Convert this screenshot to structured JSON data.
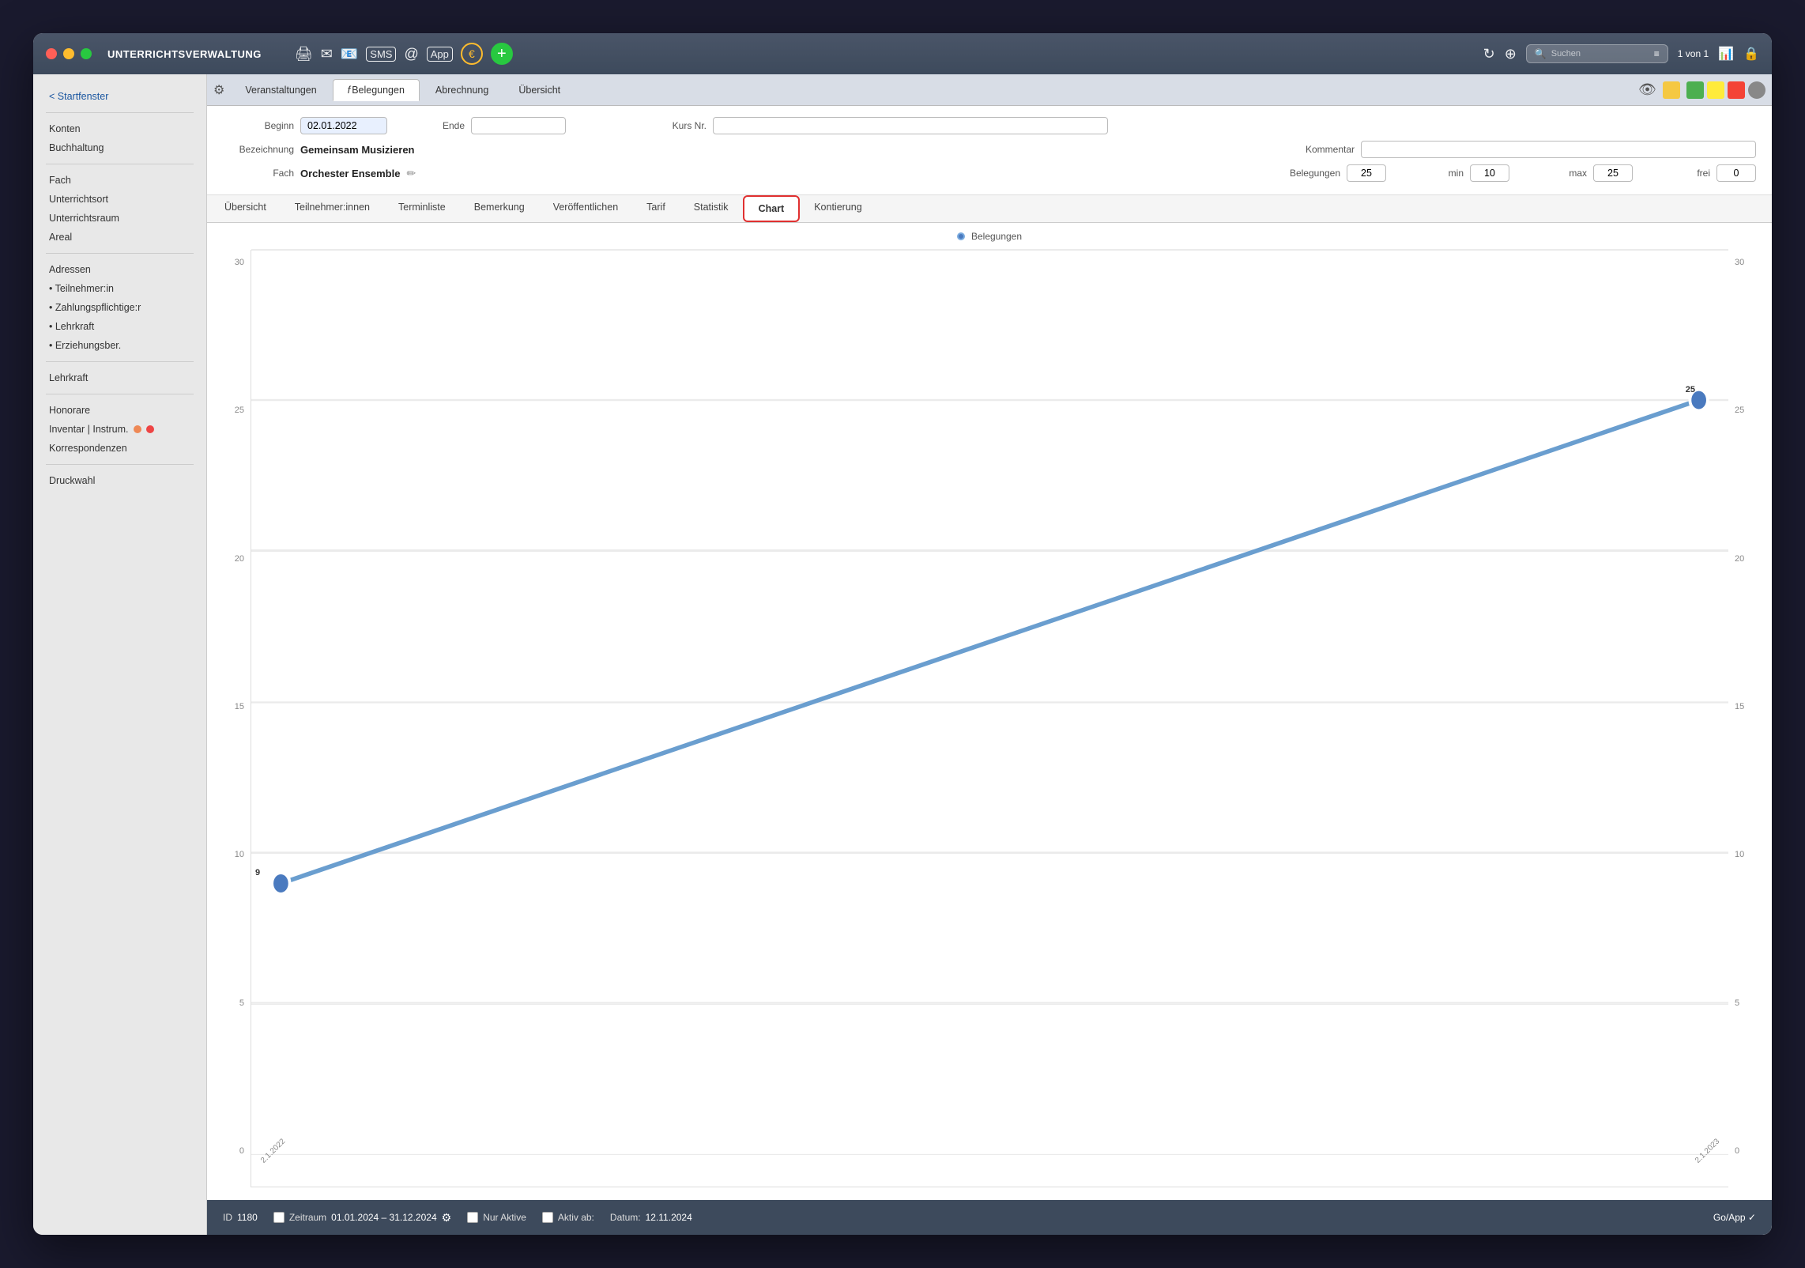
{
  "window": {
    "title": "UNTERRICHTSVERWALTUNG"
  },
  "toolbar": {
    "page_count": "1 von 1"
  },
  "sidebar": {
    "back_label": "< Startfenster",
    "items": [
      {
        "label": "Konten"
      },
      {
        "label": "Buchhaltung"
      },
      {
        "label": "Fach"
      },
      {
        "label": "Unterrichtsort"
      },
      {
        "label": "Unterrichtsraum"
      },
      {
        "label": "Areal"
      },
      {
        "label": "Adressen"
      },
      {
        "label": "• Teilnehmer:in"
      },
      {
        "label": "• Zahlungspflichtige:r"
      },
      {
        "label": "• Lehrkraft"
      },
      {
        "label": "• Erziehungsber."
      },
      {
        "label": "Lehrkraft"
      },
      {
        "label": "Honorare"
      },
      {
        "label": "Inventar | Instrum."
      },
      {
        "label": "Korrespondenzen"
      },
      {
        "label": "Druckwahl"
      }
    ]
  },
  "tabs": [
    {
      "label": "Veranstaltungen",
      "active": false
    },
    {
      "label": "Belegungen",
      "active": false
    },
    {
      "label": "Abrechnung",
      "active": false
    },
    {
      "label": "Übersicht",
      "active": false
    }
  ],
  "form": {
    "beginn_label": "Beginn",
    "beginn_value": "02.01.2022",
    "ende_label": "Ende",
    "ende_value": "",
    "kurs_nr_label": "Kurs Nr.",
    "kurs_nr_value": "",
    "bezeichnung_label": "Bezeichnung",
    "bezeichnung_value": "Gemeinsam Musizieren",
    "kommentar_label": "Kommentar",
    "kommentar_value": "",
    "fach_label": "Fach",
    "fach_value": "Orchester Ensemble",
    "belegungen_label": "Belegungen",
    "belegungen_value": "25",
    "min_label": "min",
    "min_value": "10",
    "max_label": "max",
    "max_value": "25",
    "frei_label": "frei",
    "frei_value": "0"
  },
  "sub_tabs": [
    {
      "label": "Übersicht"
    },
    {
      "label": "Teilnehmer:innen"
    },
    {
      "label": "Terminliste"
    },
    {
      "label": "Bemerkung"
    },
    {
      "label": "Veröffentlichen"
    },
    {
      "label": "Tarif"
    },
    {
      "label": "Statistik"
    },
    {
      "label": "Chart",
      "active": true,
      "highlighted": true
    },
    {
      "label": "Kontierung"
    }
  ],
  "chart": {
    "legend_label": "Belegungen",
    "y_axis_values": [
      "30",
      "25",
      "20",
      "15",
      "10",
      "5",
      "0"
    ],
    "y_axis_right_values": [
      "30",
      "25",
      "20",
      "15",
      "10",
      "5",
      "0"
    ],
    "start_date": "2.1.2022",
    "end_date": "2.1.2023",
    "start_value": 9,
    "end_value": 25,
    "start_label": "9",
    "end_label": "25"
  },
  "status_bar": {
    "id_label": "ID",
    "id_value": "1180",
    "zeitraum_label": "Zeitraum",
    "zeitraum_value": "01.01.2024 – 31.12.2024",
    "nur_aktive_label": "Nur Aktive",
    "aktiv_ab_label": "Aktiv ab:",
    "datum_label": "Datum:",
    "datum_value": "12.11.2024",
    "go_app_label": "Go/App ✓"
  }
}
